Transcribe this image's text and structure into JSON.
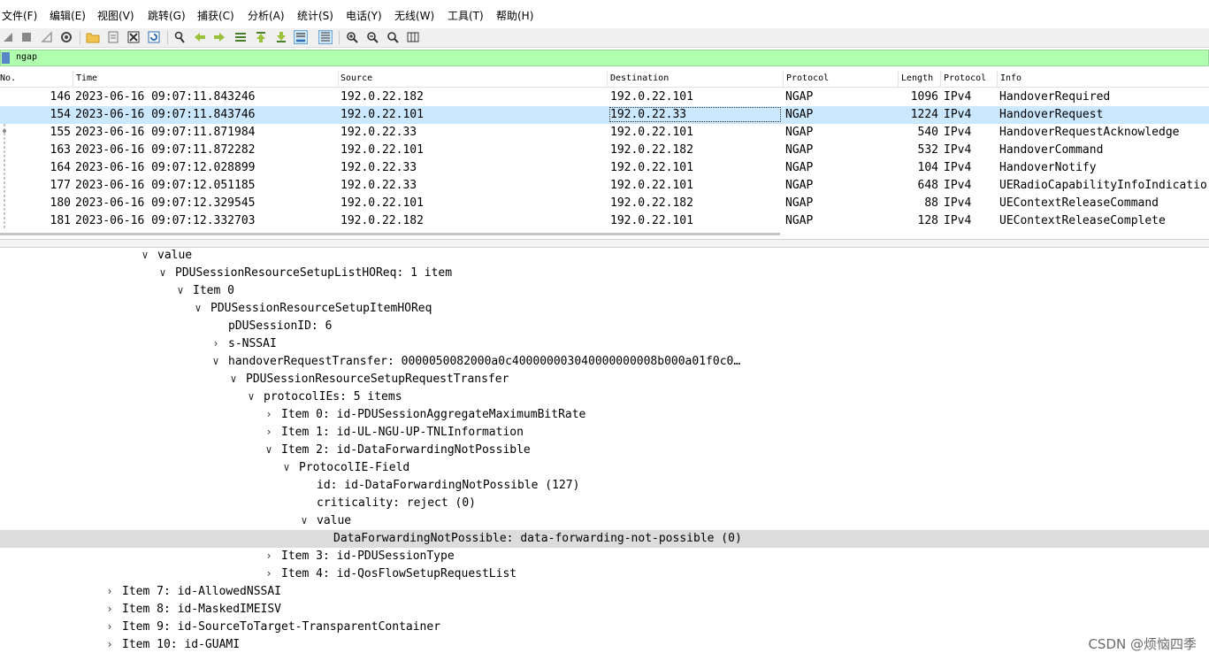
{
  "menu": [
    "文件(F)",
    "编辑(E)",
    "视图(V)",
    "跳转(G)",
    "捕获(C)",
    "分析(A)",
    "统计(S)",
    "电话(Y)",
    "无线(W)",
    "工具(T)",
    "帮助(H)"
  ],
  "toolbar": {
    "icons": [
      "shark-fin-start-icon",
      "stop-icon",
      "restart-icon",
      "options-gear-icon",
      "open-folder-icon",
      "save-file-icon",
      "close-file-icon",
      "reload-icon",
      "find-icon",
      "go-back-icon",
      "go-forward-icon",
      "go-to-packet-icon",
      "go-first-icon",
      "go-last-icon",
      "autoscroll-icon",
      "colorize-icon",
      "zoom-in-icon",
      "zoom-out-icon",
      "zoom-normal-icon",
      "resize-columns-icon"
    ]
  },
  "filter": {
    "value": "ngap"
  },
  "packet_list": {
    "columns": [
      "No.",
      "Time",
      "Source",
      "Destination",
      "Protocol",
      "Length",
      "Protocol",
      "Info"
    ],
    "rows": [
      {
        "no": "146",
        "time": "2023-06-16 09:07:11.843246",
        "src": "192.0.22.182",
        "dst": "192.0.22.101",
        "proto": "NGAP",
        "len": "1096",
        "proto2": "IPv4",
        "info": "HandoverRequired"
      },
      {
        "no": "154",
        "time": "2023-06-16 09:07:11.843746",
        "src": "192.0.22.101",
        "dst": "192.0.22.33",
        "proto": "NGAP",
        "len": "1224",
        "proto2": "IPv4",
        "info": "HandoverRequest"
      },
      {
        "no": "155",
        "time": "2023-06-16 09:07:11.871984",
        "src": "192.0.22.33",
        "dst": "192.0.22.101",
        "proto": "NGAP",
        "len": "540",
        "proto2": "IPv4",
        "info": "HandoverRequestAcknowledge"
      },
      {
        "no": "163",
        "time": "2023-06-16 09:07:11.872282",
        "src": "192.0.22.101",
        "dst": "192.0.22.182",
        "proto": "NGAP",
        "len": "532",
        "proto2": "IPv4",
        "info": "HandoverCommand"
      },
      {
        "no": "164",
        "time": "2023-06-16 09:07:12.028899",
        "src": "192.0.22.33",
        "dst": "192.0.22.101",
        "proto": "NGAP",
        "len": "104",
        "proto2": "IPv4",
        "info": "HandoverNotify"
      },
      {
        "no": "177",
        "time": "2023-06-16 09:07:12.051185",
        "src": "192.0.22.33",
        "dst": "192.0.22.101",
        "proto": "NGAP",
        "len": "648",
        "proto2": "IPv4",
        "info": "UERadioCapabilityInfoIndicatio"
      },
      {
        "no": "180",
        "time": "2023-06-16 09:07:12.329545",
        "src": "192.0.22.101",
        "dst": "192.0.22.182",
        "proto": "NGAP",
        "len": "88",
        "proto2": "IPv4",
        "info": "UEContextReleaseCommand"
      },
      {
        "no": "181",
        "time": "2023-06-16 09:07:12.332703",
        "src": "192.0.22.182",
        "dst": "192.0.22.101",
        "proto": "NGAP",
        "len": "128",
        "proto2": "IPv4",
        "info": "UEContextReleaseComplete"
      }
    ]
  },
  "details": {
    "rows": [
      {
        "arrow": "∨",
        "text": "value"
      },
      {
        "arrow": "∨",
        "text": "PDUSessionResourceSetupListHOReq: 1 item"
      },
      {
        "arrow": "∨",
        "text": "Item 0"
      },
      {
        "arrow": "∨",
        "text": "PDUSessionResourceSetupItemHOReq"
      },
      {
        "arrow": "",
        "text": "pDUSessionID: 6"
      },
      {
        "arrow": "›",
        "text": "s-NSSAI"
      },
      {
        "arrow": "∨",
        "text": "handoverRequestTransfer: 0000050082000a0c400000003040000000008b000a01f0c0…"
      },
      {
        "arrow": "∨",
        "text": "PDUSessionResourceSetupRequestTransfer"
      },
      {
        "arrow": "∨",
        "text": "protocolIEs: 5 items"
      },
      {
        "arrow": "›",
        "text": "Item 0: id-PDUSessionAggregateMaximumBitRate"
      },
      {
        "arrow": "›",
        "text": "Item 1: id-UL-NGU-UP-TNLInformation"
      },
      {
        "arrow": "∨",
        "text": "Item 2: id-DataForwardingNotPossible"
      },
      {
        "arrow": "∨",
        "text": "ProtocolIE-Field"
      },
      {
        "arrow": "",
        "text": "id: id-DataForwardingNotPossible (127)"
      },
      {
        "arrow": "",
        "text": "criticality: reject (0)"
      },
      {
        "arrow": "∨",
        "text": "value"
      },
      {
        "arrow": "",
        "text": "DataForwardingNotPossible: data-forwarding-not-possible (0)"
      },
      {
        "arrow": "›",
        "text": "Item 3: id-PDUSessionType"
      },
      {
        "arrow": "›",
        "text": "Item 4: id-QosFlowSetupRequestList"
      },
      {
        "arrow": "›",
        "text": "Item 7: id-AllowedNSSAI"
      },
      {
        "arrow": "›",
        "text": "Item 8: id-MaskedIMEISV"
      },
      {
        "arrow": "›",
        "text": "Item 9: id-SourceToTarget-TransparentContainer"
      },
      {
        "arrow": "›",
        "text": "Item 10: id-GUAMI"
      }
    ]
  },
  "watermark": "CSDN @烦恼四季"
}
